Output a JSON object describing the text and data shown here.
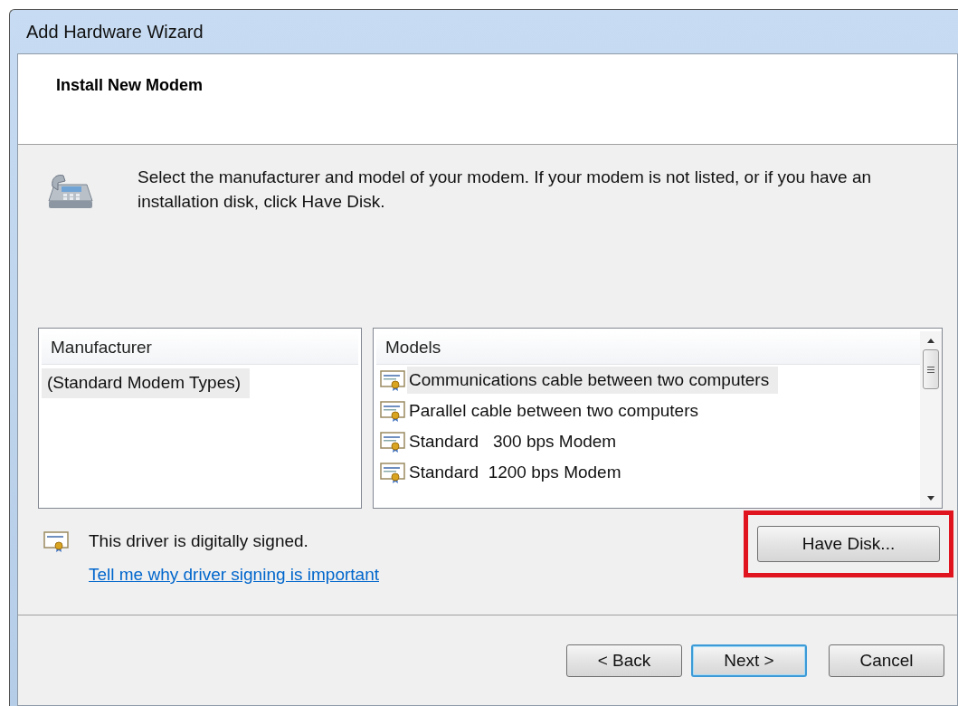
{
  "window": {
    "title": "Add Hardware Wizard"
  },
  "header": {
    "title": "Install New Modem"
  },
  "instruction": "Select the manufacturer and model of your modem. If your modem is not listed, or if you have an installation disk, click Have Disk.",
  "manufacturer_list": {
    "heading": "Manufacturer",
    "items": [
      {
        "label": "(Standard Modem Types)",
        "selected": true
      }
    ]
  },
  "models_list": {
    "heading": "Models",
    "items": [
      {
        "label": "Communications cable between two computers",
        "selected": true
      },
      {
        "label": "Parallel cable between two computers",
        "selected": false
      },
      {
        "label": "Standard   300 bps Modem",
        "selected": false
      },
      {
        "label": "Standard  1200 bps Modem",
        "selected": false
      }
    ]
  },
  "signing": {
    "text": "This driver is digitally signed.",
    "link": "Tell me why driver signing is important"
  },
  "have_disk_button": {
    "label": "Have Disk...",
    "highlighted": true
  },
  "buttons": [
    {
      "label": "< Back",
      "default": false
    },
    {
      "label": "Next >",
      "default": true
    },
    {
      "label": "Cancel",
      "default": false
    }
  ]
}
